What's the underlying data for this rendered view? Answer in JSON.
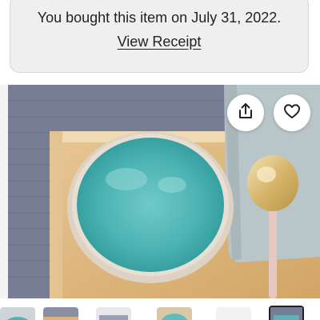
{
  "receipt": {
    "purchase_text": "You bought this item on July 31, 2022.",
    "view_receipt_label": "View Receipt"
  },
  "listing_image": {
    "share_icon": "share-icon",
    "favorite_icon": "heart-icon"
  },
  "thumbnails": {
    "count_visible": 6,
    "selected_index": 5
  },
  "colors": {
    "banner_bg": "#efefef",
    "text": "#222222",
    "bowl_glaze": "#4bb5b5"
  }
}
